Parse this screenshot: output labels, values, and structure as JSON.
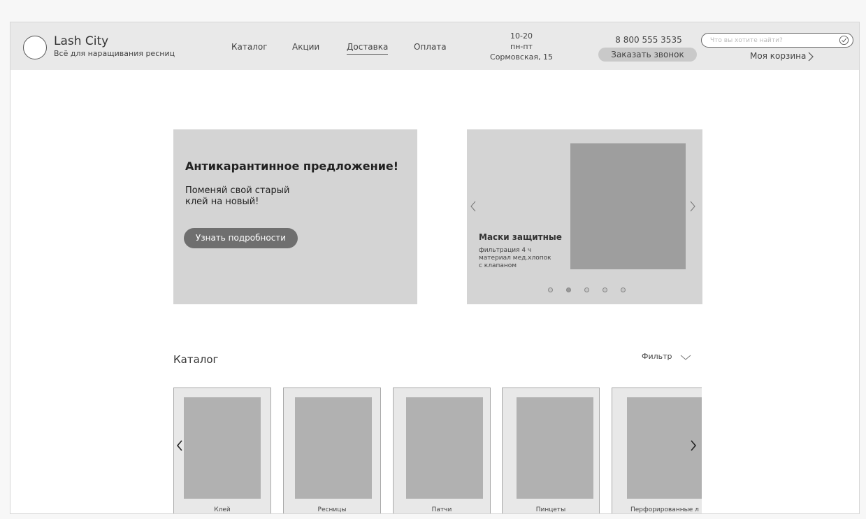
{
  "header": {
    "brand": "Lash City",
    "tagline": "Всё для наращивания ресниц",
    "nav": [
      {
        "label": "Каталог",
        "active": false
      },
      {
        "label": "Акции",
        "active": false
      },
      {
        "label": "Доставка",
        "active": true
      },
      {
        "label": "Оплата",
        "active": false
      }
    ],
    "hours": {
      "time": "10-20",
      "days": "пн-пт",
      "address": "Сормовская, 15"
    },
    "phone": "8 800 555 3535",
    "callback_label": "Заказать звонок",
    "search": {
      "placeholder": "Что вы хотите найти?",
      "value": ""
    },
    "cart_label": "Моя корзина"
  },
  "promo": {
    "title": "Антикарантинное предложение!",
    "text_line1": "Поменяй свой старый",
    "text_line2": "клей на новый!",
    "button_label": "Узнать подробности"
  },
  "slider": {
    "title": "Маски защитные",
    "features": [
      "фильтрация 4 ч",
      "материал мед.хлопок",
      "с клапаном"
    ],
    "dots_count": 5,
    "active_dot": 2
  },
  "catalog": {
    "title": "Каталог",
    "filter_label": "Фильтр",
    "items": [
      {
        "label": "Клей"
      },
      {
        "label": "Ресницы"
      },
      {
        "label": "Патчи"
      },
      {
        "label": "Пинцеты"
      },
      {
        "label": "Перфорированные л"
      }
    ]
  },
  "icons": {
    "search_ok": "check-circle-icon",
    "cart": "chevron-right-icon",
    "filter": "chevron-down-icon"
  },
  "colors": {
    "header_bg": "#e9e9e9",
    "panel_bg": "#d4d4d4",
    "button_dark": "#6f6f6f",
    "image_placeholder": "#9e9e9e"
  }
}
